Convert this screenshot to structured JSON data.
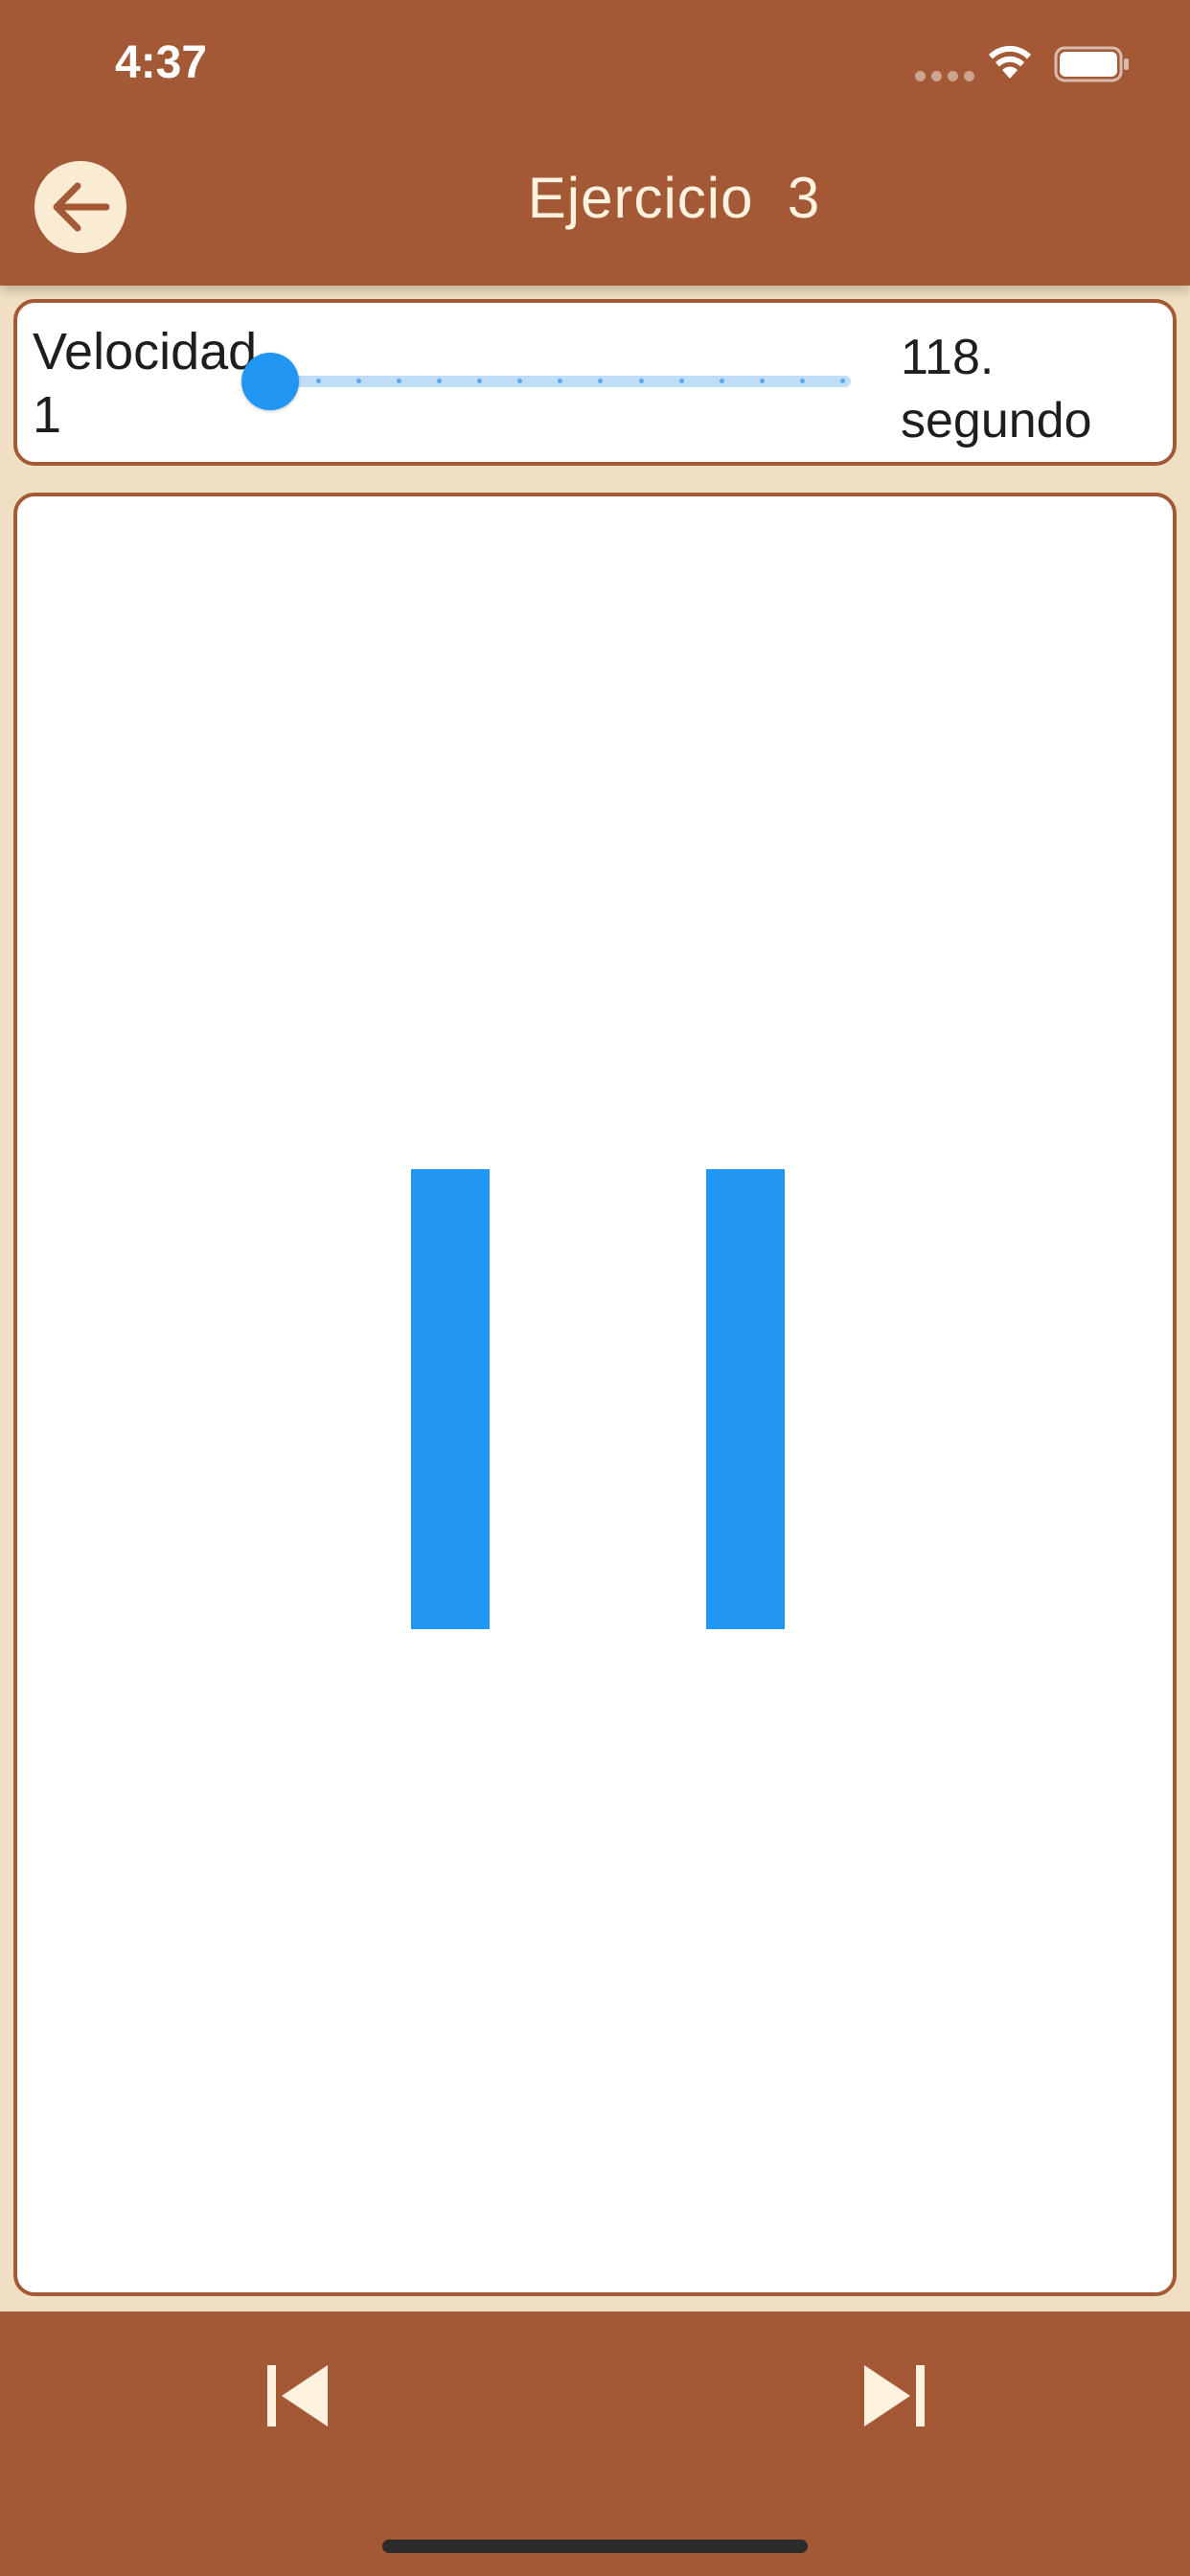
{
  "status_bar": {
    "time": "4:37"
  },
  "header": {
    "title": "Ejercicio  3"
  },
  "speed_control": {
    "label": "Velocidad 1",
    "value_text": "118. segundo",
    "slider_level": 1,
    "slider_steps": 15
  },
  "colors": {
    "bar_color": "#A45936",
    "accent": "#2196F3",
    "background": "#F1DFC3",
    "back_button_bg": "#FBEBD3"
  },
  "icons": {
    "back": "arrow-left-icon",
    "previous": "skip-previous-icon",
    "next": "skip-next-icon"
  }
}
